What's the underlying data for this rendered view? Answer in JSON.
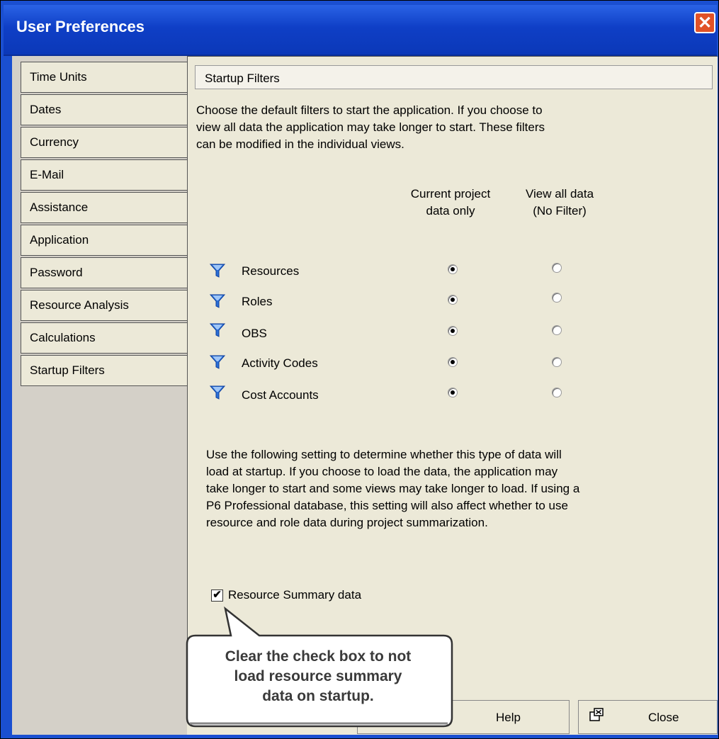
{
  "window": {
    "title": "User Preferences",
    "close_glyph": "✕"
  },
  "tabs": [
    {
      "label": "Time Units",
      "active": false
    },
    {
      "label": "Dates",
      "active": false
    },
    {
      "label": "Currency",
      "active": false
    },
    {
      "label": "E-Mail",
      "active": false
    },
    {
      "label": "Assistance",
      "active": false
    },
    {
      "label": "Application",
      "active": false
    },
    {
      "label": "Password",
      "active": false
    },
    {
      "label": "Resource Analysis",
      "active": false
    },
    {
      "label": "Calculations",
      "active": false
    },
    {
      "label": "Startup Filters",
      "active": true
    }
  ],
  "panel": {
    "header": "Startup Filters",
    "intro_lines": [
      "Choose the default filters to start the application.  If you choose to",
      "view all data the application may take longer to start.  These filters",
      "can be modified in the individual views."
    ],
    "col1": [
      "Current project",
      "data only"
    ],
    "col2": [
      "View all data",
      "(No Filter)"
    ],
    "filters": [
      {
        "label": "Resources",
        "selected": "current"
      },
      {
        "label": "Roles",
        "selected": "current"
      },
      {
        "label": "OBS",
        "selected": "current"
      },
      {
        "label": "Activity Codes",
        "selected": "current"
      },
      {
        "label": "Cost Accounts",
        "selected": "current"
      }
    ],
    "para2_lines": [
      "Use the following setting to determine whether this type of data will",
      "load at startup. If you choose to load the data, the application may",
      "take longer to start and some views may take longer to load. If using a",
      "P6 Professional database, this setting will also affect whether to use",
      "resource and role data during project summarization."
    ],
    "checkbox": {
      "label": "Resource Summary data",
      "checked": true
    }
  },
  "buttons": {
    "help": "Help",
    "close": "Close"
  },
  "callout": {
    "lines": [
      "Clear the check box to not",
      "load resource summary",
      "data on startup."
    ]
  },
  "colors": {
    "filter_icon": "#2b6fd6",
    "titlebar": "#0f3fc6",
    "close_button": "#e15227"
  }
}
